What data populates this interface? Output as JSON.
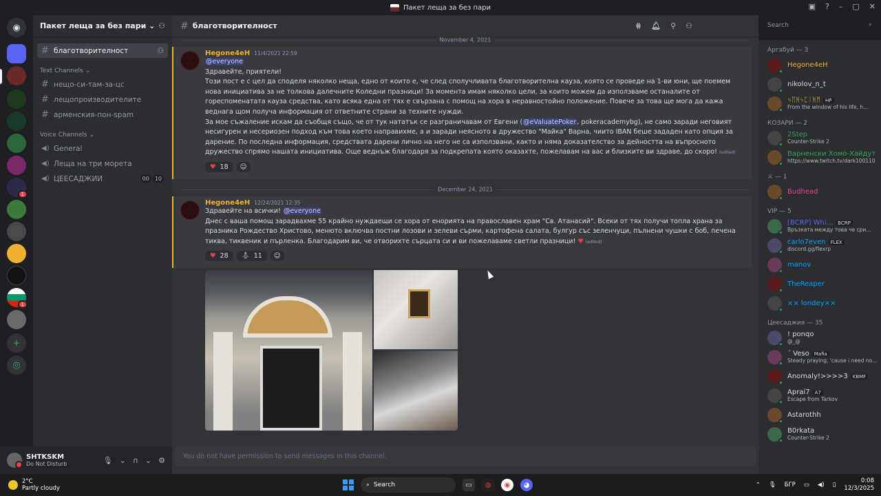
{
  "window": {
    "title": "Пакет леща за без пари"
  },
  "guild": {
    "name": "Пакет леща за без пари"
  },
  "channels": {
    "active": "благотворителност",
    "text_category": "Text Channels",
    "text": [
      "нещо-си-там-за-цс",
      "лещопроизводителите",
      "арменския-пон-spam"
    ],
    "voice_category": "Voice Channels",
    "voice": [
      "General",
      "Леща на три морета",
      "ЦЕЕСАДЖИИ"
    ],
    "voice_badge_a": "00",
    "voice_badge_b": "10"
  },
  "user": {
    "name": "SHTKSKM",
    "status": "Do Not Disturb"
  },
  "header": {
    "channel": "благотворителност",
    "search_placeholder": "Search"
  },
  "dividers": [
    "November 4, 2021",
    "December 24, 2021"
  ],
  "msg1": {
    "author": "Hegone4eH",
    "time": "11/4/2021 22:59",
    "mention": "@everyone",
    "greeting": "Здравейте, приятели!",
    "p1": "Този пост е с цел да споделя няколко неща, едно от които е, че след сполучливата благотворителна кауза, която се проведе на 1-ви юни, ще поемем нова инициатива за не толкова далечните Коледни празници! За момента имам няколко цели, за които можем да използваме останалите от гореспоменатата кауза средства, като всяка една от тях е свързана с помощ на хора в неравностойно положение. Повече за това ще мога да кажа веднага щом получа информация от ответните страни за техните нужди.",
    "p2a": "За мое съжаление искам да съобщя също, че от тук нататък се разграничавам от Евгени (",
    "p2m": "@eValuatePoker",
    "p2b": ", pokeracademybg), не само заради неговият несигурен и несериозен подход към това което направихме, а и заради неясното в дружество \"Майка\" Варна, чиито IBAN беше зададен като опция за дарение. По последна информация, средствата дарени лично на него не са използвани, както и няма доказателство за дейността на въпросното дружество спрямо нашата инициатива. Още веднъж благодаря за подкрепата която оказахте, пожелавам на вас и близките ви здраве, до скоро!",
    "edited": "(edited)",
    "reaction_count": "18"
  },
  "msg2": {
    "author": "Hegone4eH",
    "time": "12/24/2021 12:35",
    "greet": "Здравейте на всички! ",
    "mention": "@everyone",
    "body": "Днес с ваша помощ зарадвахме 55 крайно нуждаещи се хора от енорията на православен храм \"Св. Атанасий\". Всеки от тях получи топла храна за празника Рождество Христово, менюто включва постни лозови и зелеви сърми, картофена салата, булгур със зеленчуци, пълнени чушки с боб, печена тиква, тиквеник и пърленка. Благодарим ви, че отворихте сърцата си и ви пожелаваме светли празници!",
    "edited": "(edited)",
    "reaction_heart": "28",
    "reaction_pray": "11"
  },
  "composer": {
    "placeholder": "You do not have permission to send messages in this channel."
  },
  "members": {
    "groups": [
      {
        "title": "Аргабуй — 3",
        "items": [
          {
            "name": "Hegone4eH",
            "sub": "",
            "color": "#f0b232",
            "tag": ""
          },
          {
            "name": "nikolov_n_t",
            "sub": "",
            "color": "#dbdee1",
            "tag": ""
          },
          {
            "name": "ᛃᛖᚻᛃᛈᛁᚻᛗ",
            "sub": "From the window of his life, h...",
            "color": "#f0b232",
            "tag": "HP"
          }
        ]
      },
      {
        "title": "КОЗАРИ — 2",
        "items": [
          {
            "name": "2Step",
            "sub": "Counter-Strike 2",
            "color": "#3ba55d",
            "tag": ""
          },
          {
            "name": "Варненски Хомо-Хайдут",
            "sub": "https://www.twitch.tv/dark100110",
            "color": "#3ba55d",
            "tag": ""
          }
        ]
      },
      {
        "title": "⚔ — 1",
        "items": [
          {
            "name": "Budhead",
            "sub": "",
            "color": "#eb459e",
            "tag": ""
          }
        ]
      },
      {
        "title": "VIP — 5",
        "items": [
          {
            "name": "[BCRP] Whi...",
            "sub": "Връзката между това че сри...",
            "color": "#5865f2",
            "tag": "BCRP"
          },
          {
            "name": "carlo7even",
            "sub": "discord.gg/flexrp",
            "color": "#00a8fc",
            "tag": "FLEX"
          },
          {
            "name": "manov",
            "sub": "",
            "color": "#00a8fc",
            "tag": ""
          },
          {
            "name": "TheReaper",
            "sub": "",
            "color": "#00a8fc",
            "tag": ""
          },
          {
            "name": "×× londey××",
            "sub": "",
            "color": "#00a8fc",
            "tag": ""
          }
        ]
      },
      {
        "title": "Цеесаджия — 35",
        "items": [
          {
            "name": "! ponqo",
            "sub": "@_@",
            "color": "#dbdee1",
            "tag": ""
          },
          {
            "name": "´ Veso",
            "sub": "Steady praying, 'cause i need no...",
            "color": "#dbdee1",
            "tag": "Mafia"
          },
          {
            "name": "Anomaly!>>>>3",
            "sub": "",
            "color": "#dbdee1",
            "tag": "KBMF"
          },
          {
            "name": "Apraí7",
            "sub": "Escape from Tarkov",
            "color": "#dbdee1",
            "tag": "A7"
          },
          {
            "name": "Astarothh",
            "sub": "",
            "color": "#dbdee1",
            "tag": ""
          },
          {
            "name": "B0rkata",
            "sub": "Counter-Strike 2",
            "color": "#dbdee1",
            "tag": ""
          }
        ]
      }
    ]
  },
  "taskbar": {
    "temp": "2°C",
    "weather": "Partly cloudy",
    "search": "Search",
    "lang": "БГР",
    "time": "0:08",
    "date": "12/3/2025"
  }
}
